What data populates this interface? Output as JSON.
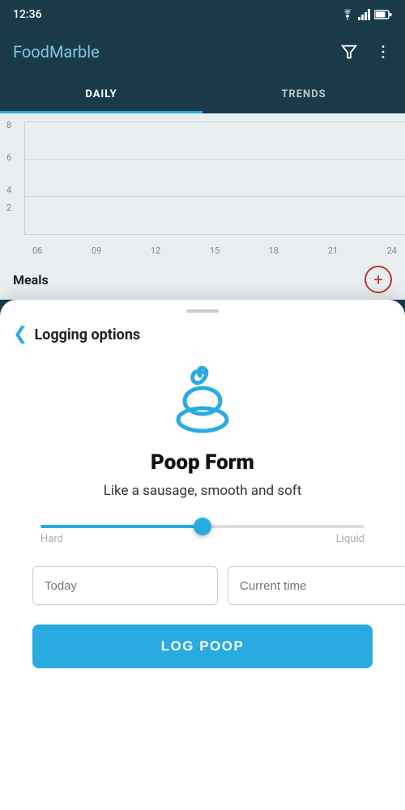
{
  "statusBar": {
    "time": "12:36",
    "icons": [
      "settings",
      "signal-boost",
      "play",
      "clipboard",
      "bullet"
    ]
  },
  "appBar": {
    "title": "FoodMarble",
    "filterIcon": "filter-icon",
    "moreIcon": "more-icon"
  },
  "tabs": [
    {
      "id": "daily",
      "label": "DAILY",
      "active": true
    },
    {
      "id": "trends",
      "label": "TRENDS",
      "active": false
    }
  ],
  "chart": {
    "yLabels": [
      "8",
      "6",
      "4",
      "2"
    ],
    "xLabels": [
      "06",
      "09",
      "12",
      "15",
      "18",
      "21",
      "24"
    ]
  },
  "mealsRow": {
    "label": "Meals",
    "addButtonLabel": "+"
  },
  "bottomSheet": {
    "dragHandle": true,
    "backLabel": "<",
    "headerTitle": "Logging options",
    "formTitle": "Poop Form",
    "formSubtitle": "Like a sausage, smooth and soft",
    "slider": {
      "leftLabel": "Hard",
      "rightLabel": "Liquid",
      "value": 50
    },
    "dateField": {
      "placeholder": "Today",
      "value": ""
    },
    "timeField": {
      "placeholder": "Current time",
      "value": ""
    },
    "logButton": "LOG POOP"
  }
}
